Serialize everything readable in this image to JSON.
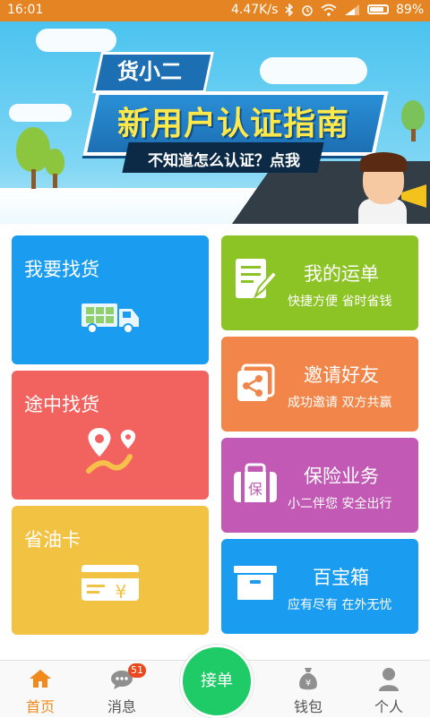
{
  "status_bar": {
    "time": "16:01",
    "net_speed": "4.47K/s",
    "battery": "89%",
    "icons": [
      "bluetooth-icon",
      "alarm-icon",
      "wifi-icon",
      "signal-icon",
      "battery-icon"
    ]
  },
  "banner": {
    "brand": "货小二",
    "title": "新用户认证指南",
    "subtitle": "不知道怎么认证？点我",
    "slides": 3,
    "active_slide": 1
  },
  "tiles": {
    "find_cargo": {
      "title": "我要找货",
      "color": "#1a9cf0",
      "icon": "truck-icon"
    },
    "enroute_cargo": {
      "title": "途中找货",
      "color": "#f2625f",
      "icon": "route-pin-icon"
    },
    "fuel_card": {
      "title": "省油卡",
      "color": "#f2c343",
      "icon": "yuan-card-icon"
    },
    "my_waybill": {
      "title": "我的运单",
      "subtitle": "快捷方便 省时省钱",
      "color": "#8cc325",
      "icon": "edit-document-icon"
    },
    "invite": {
      "title": "邀请好友",
      "subtitle": "成功邀请 双方共赢",
      "color": "#f2864a",
      "icon": "share-icon"
    },
    "insurance": {
      "title": "保险业务",
      "subtitle": "小二伴您 安全出行",
      "color": "#c25ab5",
      "icon": "insurance-bag-icon"
    },
    "toolbox": {
      "title": "百宝箱",
      "subtitle": "应有尽有 在外无忧",
      "color": "#1a9cf0",
      "icon": "box-icon"
    }
  },
  "bottom_nav": {
    "home": "首页",
    "messages": "消息",
    "messages_badge": "51",
    "accept_order": "接单",
    "wallet": "钱包",
    "profile": "个人",
    "active": "home",
    "active_color": "#f08a1c",
    "accept_color": "#1fcb67"
  }
}
